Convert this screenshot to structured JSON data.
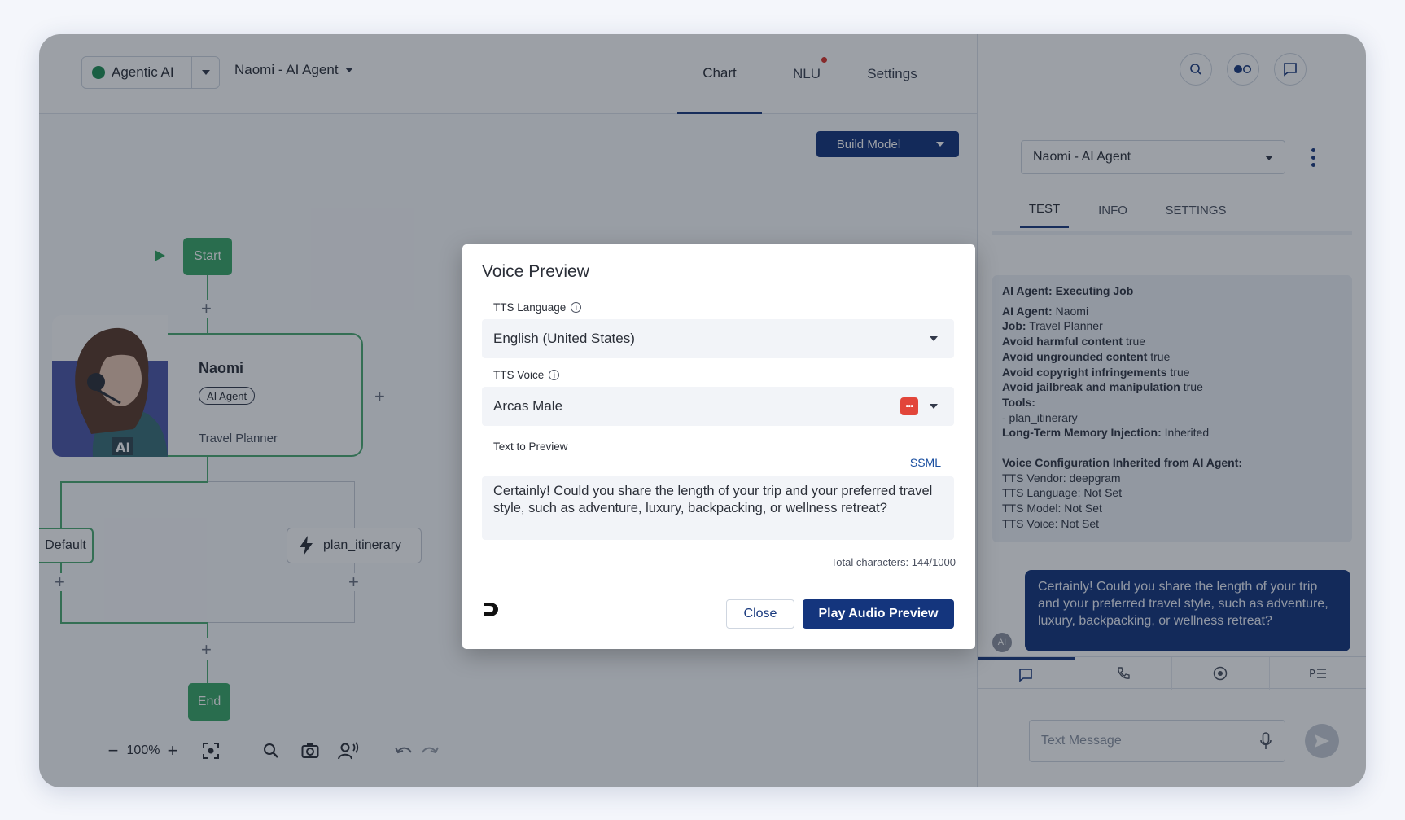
{
  "header": {
    "agent_switch_label": "Agentic AI",
    "agent_name": "Naomi - AI Agent",
    "tabs": [
      {
        "label": "Chart"
      },
      {
        "label": "NLU"
      },
      {
        "label": "Settings"
      }
    ],
    "build_model_label": "Build Model"
  },
  "flow": {
    "start_label": "Start",
    "agent_card": {
      "title": "Naomi",
      "badge": "AI Agent",
      "subtitle": "Travel Planner",
      "avatar_badge": "AI"
    },
    "default_label": "Default",
    "plan_node_label": "plan_itinerary",
    "end_label": "End"
  },
  "toolbar": {
    "zoom": "100%"
  },
  "right_panel": {
    "agent_select": "Naomi - AI Agent",
    "tabs": [
      {
        "label": "TEST"
      },
      {
        "label": "INFO"
      },
      {
        "label": "SETTINGS"
      }
    ],
    "job_card": {
      "heading": "AI Agent: Executing Job",
      "rows": [
        {
          "k": "AI Agent:",
          "v": "Naomi"
        },
        {
          "k": "Job:",
          "v": "Travel Planner"
        },
        {
          "k": "Avoid harmful content",
          "v": "true"
        },
        {
          "k": "Avoid ungrounded content",
          "v": "true"
        },
        {
          "k": "Avoid copyright infringements",
          "v": "true"
        },
        {
          "k": "Avoid jailbreak and manipulation",
          "v": "true"
        },
        {
          "k": "Tools:",
          "v": ""
        }
      ],
      "tool_item": "- plan_itinerary",
      "memory_key": "Long-Term Memory Injection:",
      "memory_val": "Inherited",
      "voice_heading": "Voice Configuration Inherited from AI Agent:",
      "voice_rows": [
        "TTS Vendor: deepgram",
        "TTS Language: Not Set",
        "TTS Model: Not Set",
        "TTS Voice: Not Set"
      ]
    },
    "bubble_text": "Certainly! Could you share the length of your trip and your preferred travel style, such as adventure, luxury, backpacking, or wellness retreat?",
    "ai_avatar": "AI",
    "message_placeholder": "Text Message"
  },
  "modal": {
    "title": "Voice Preview",
    "tts_language_label": "TTS Language",
    "tts_language_value": "English (United States)",
    "tts_voice_label": "TTS Voice",
    "tts_voice_value": "Arcas Male",
    "text_label": "Text to Preview",
    "ssml_label": "SSML",
    "text_value": "Certainly! Could you share the length of your trip and your preferred travel style, such as adventure, luxury, backpacking, or wellness retreat?",
    "total_chars": "Total characters: 144/1000",
    "close_label": "Close",
    "play_label": "Play Audio Preview"
  },
  "colors": {
    "brand": "#14357d",
    "flow_green": "#3aa868",
    "nlu_dot": "#d9342b"
  }
}
